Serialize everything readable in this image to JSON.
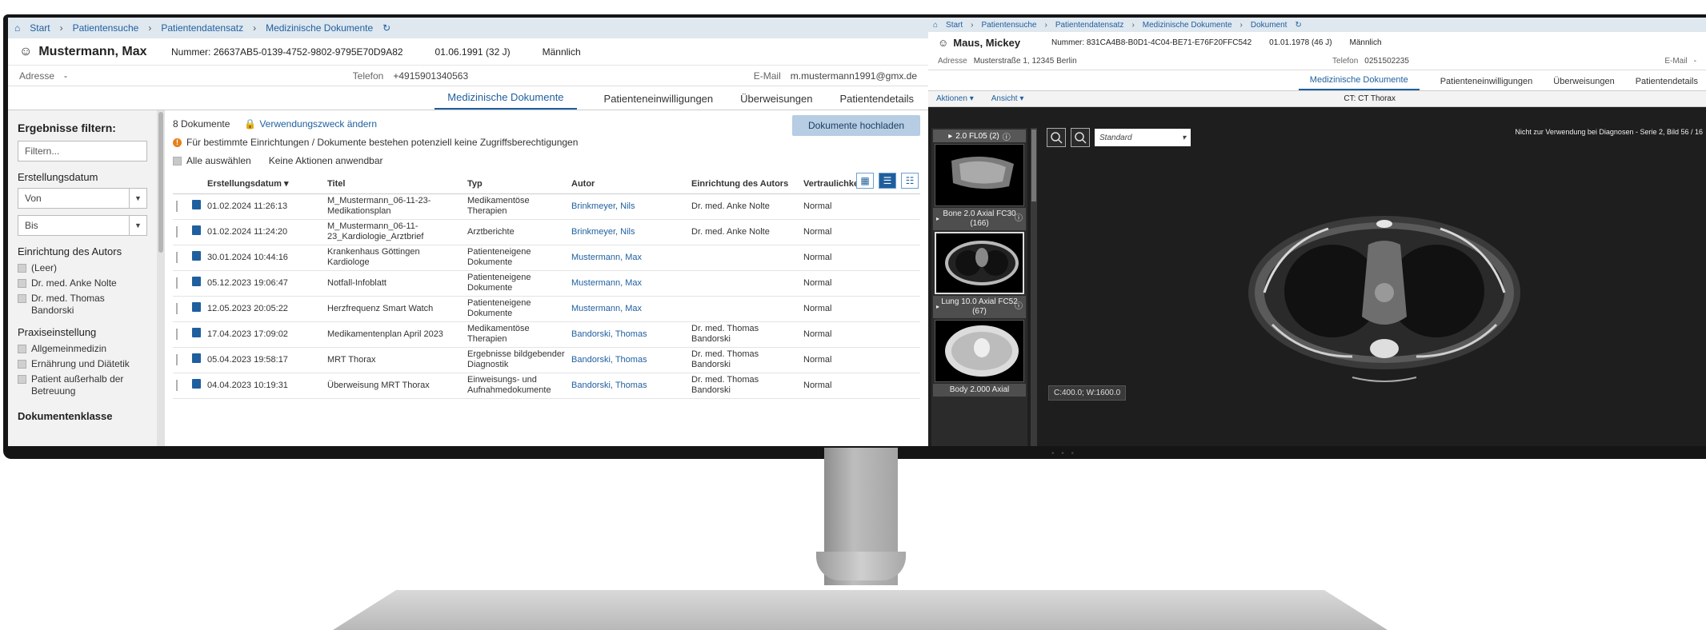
{
  "left": {
    "breadcrumb": [
      "Start",
      "Patientensuche",
      "Patientendatensatz",
      "Medizinische Dokumente"
    ],
    "patient": {
      "name": "Mustermann, Max",
      "number_label": "Nummer:",
      "number": "26637AB5-0139-4752-9802-9795E70D9A82",
      "dob": "01.06.1991 (32 J)",
      "sex": "Männlich",
      "address_label": "Adresse",
      "address": "-",
      "phone_label": "Telefon",
      "phone": "+4915901340563",
      "email_label": "E-Mail",
      "email": "m.mustermann1991@gmx.de"
    },
    "tabs": [
      "Medizinische Dokumente",
      "Patienteneinwilligungen",
      "Überweisungen",
      "Patientendetails"
    ],
    "filters": {
      "title": "Ergebnisse filtern:",
      "search_placeholder": "Filtern...",
      "created_label": "Erstellungsdatum",
      "from": "Von",
      "to": "Bis",
      "author_facility_label": "Einrichtung des Autors",
      "author_facility_options": [
        "(Leer)",
        "Dr. med. Anke Nolte",
        "Dr. med. Thomas Bandorski"
      ],
      "practice_label": "Praxiseinstellung",
      "practice_options": [
        "Allgemeinmedizin",
        "Ernährung und Diätetik",
        "Patient außerhalb der Betreuung"
      ],
      "doc_class_label": "Dokumentenklasse"
    },
    "main": {
      "count": "8 Dokumente",
      "purpose_link": "Verwendungszweck ändern",
      "upload_button": "Dokumente hochladen",
      "warning": "Für bestimmte Einrichtungen / Dokumente bestehen potenziell keine Zugriffsberechtigungen",
      "select_all": "Alle auswählen",
      "no_actions": "Keine Aktionen anwendbar",
      "columns": [
        "Erstellungsdatum",
        "Titel",
        "Typ",
        "Autor",
        "Einrichtung des Autors",
        "Vertraulichkeit"
      ],
      "rows": [
        {
          "date": "01.02.2024 11:26:13",
          "title": "M_Mustermann_06-11-23-Medikationsplan",
          "type": "Medikamentöse Therapien",
          "author": "Brinkmeyer, Nils",
          "facility": "Dr. med. Anke Nolte",
          "conf": "Normal"
        },
        {
          "date": "01.02.2024 11:24:20",
          "title": "M_Mustermann_06-11-23_Kardiologie_Arztbrief",
          "type": "Arztberichte",
          "author": "Brinkmeyer, Nils",
          "facility": "Dr. med. Anke Nolte",
          "conf": "Normal"
        },
        {
          "date": "30.01.2024 10:44:16",
          "title": "Krankenhaus Göttingen Kardiologe",
          "type": "Patienteneigene Dokumente",
          "author": "Mustermann, Max",
          "facility": "",
          "conf": "Normal"
        },
        {
          "date": "05.12.2023 19:06:47",
          "title": "Notfall-Infoblatt",
          "type": "Patienteneigene Dokumente",
          "author": "Mustermann, Max",
          "facility": "",
          "conf": "Normal"
        },
        {
          "date": "12.05.2023 20:05:22",
          "title": "Herzfrequenz Smart Watch",
          "type": "Patienteneigene Dokumente",
          "author": "Mustermann, Max",
          "facility": "",
          "conf": "Normal"
        },
        {
          "date": "17.04.2023 17:09:02",
          "title": "Medikamentenplan April 2023",
          "type": "Medikamentöse Therapien",
          "author": "Bandorski, Thomas",
          "facility": "Dr. med. Thomas Bandorski",
          "conf": "Normal"
        },
        {
          "date": "05.04.2023 19:58:17",
          "title": "MRT Thorax",
          "type": "Ergebnisse bildgebender Diagnostik",
          "author": "Bandorski, Thomas",
          "facility": "Dr. med. Thomas Bandorski",
          "conf": "Normal"
        },
        {
          "date": "04.04.2023 10:19:31",
          "title": "Überweisung MRT Thorax",
          "type": "Einweisungs- und Aufnahmedokumente",
          "author": "Bandorski, Thomas",
          "facility": "Dr. med. Thomas Bandorski",
          "conf": "Normal"
        }
      ]
    }
  },
  "right": {
    "breadcrumb": [
      "Start",
      "Patientensuche",
      "Patientendatensatz",
      "Medizinische Dokumente",
      "Dokument"
    ],
    "patient": {
      "name": "Maus, Mickey",
      "number_label": "Nummer:",
      "number": "831CA4B8-B0D1-4C04-BE71-E76F20FFC542",
      "dob": "01.01.1978 (46 J)",
      "sex": "Männlich",
      "address_label": "Adresse",
      "address": "Musterstraße 1, 12345 Berlin",
      "phone_label": "Telefon",
      "phone": "0251502235",
      "email_label": "E-Mail",
      "email": "-"
    },
    "tabs": [
      "Medizinische Dokumente",
      "Patienteneinwilligungen",
      "Überweisungen",
      "Patientendetails"
    ],
    "toolbar": {
      "actions": "Aktionen",
      "view": "Ansicht",
      "title": "CT: CT Thorax"
    },
    "viewer": {
      "series_header": "2.0 FL05 (2)",
      "series": [
        {
          "label": "Bone 2.0 Axial FC30 (166)"
        },
        {
          "label": "Lung 10.0 Axial FC52 (67)"
        },
        {
          "label": "Body 2.000 Axial"
        }
      ],
      "preset": "Standard",
      "notice": "Nicht zur Verwendung bei Diagnosen - Serie 2, Bild 56 / 16",
      "window_level": "C:400.0; W:1600.0"
    }
  }
}
